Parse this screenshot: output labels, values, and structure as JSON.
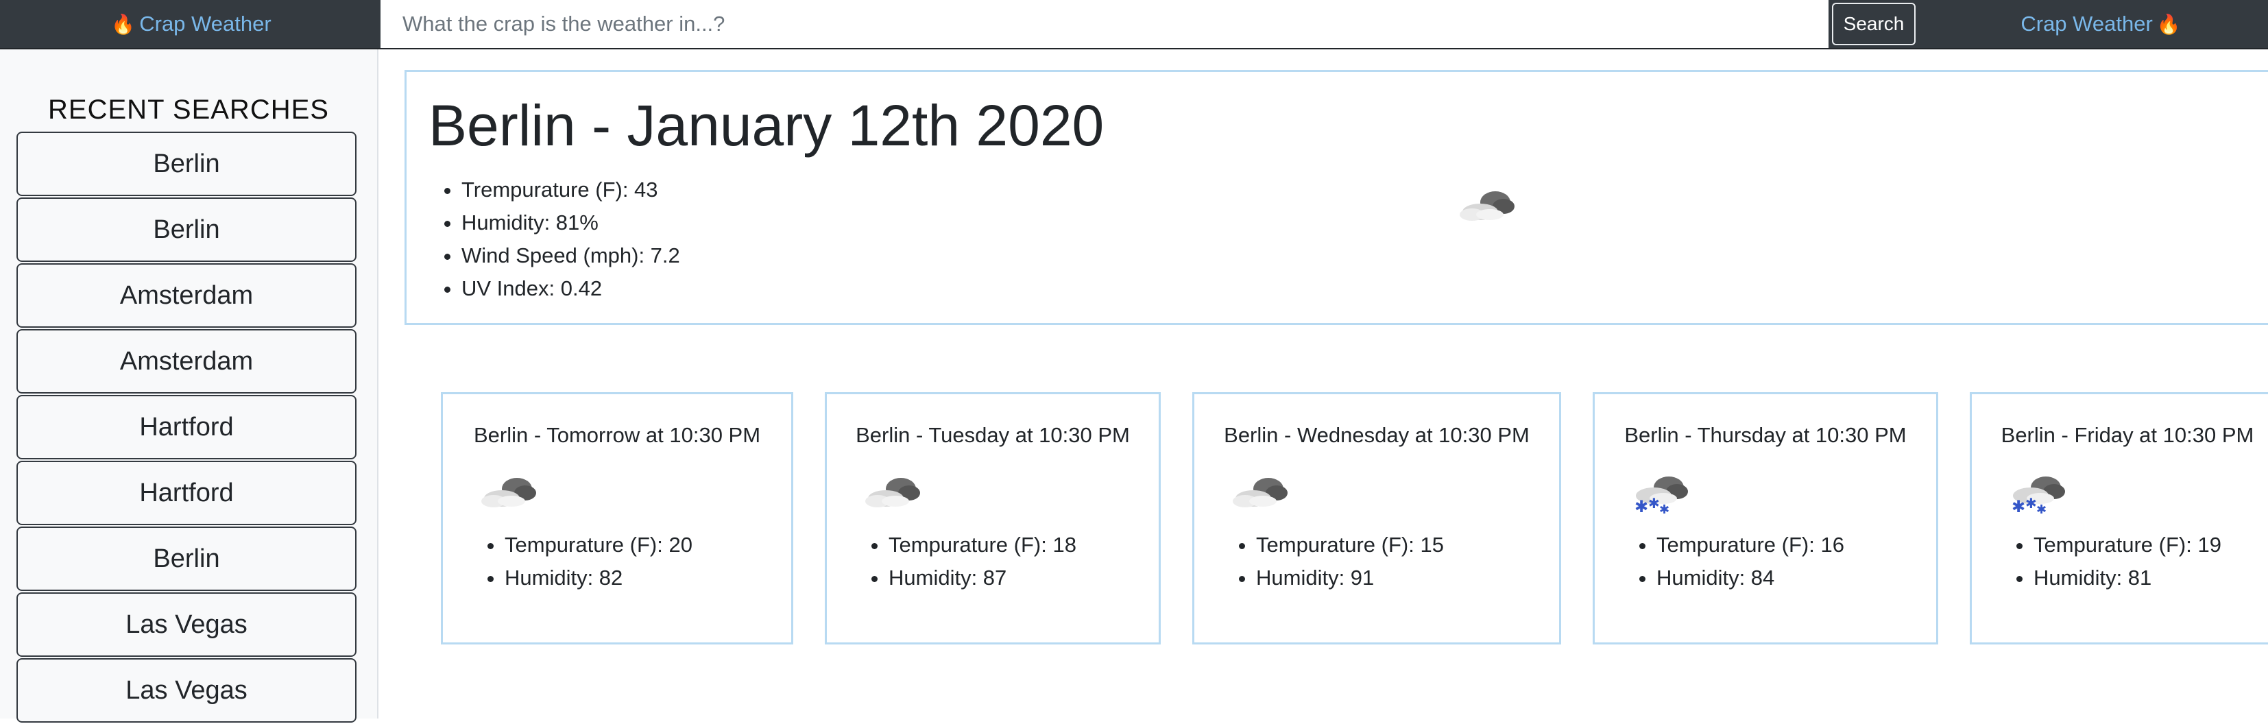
{
  "nav": {
    "brand_left": "Crap Weather",
    "brand_right": "Crap Weather",
    "search": {
      "placeholder": "What the crap is the weather in...?",
      "value": ""
    },
    "search_button": "Search"
  },
  "sidebar": {
    "title": "RECENT SEARCHES",
    "items": [
      {
        "label": "Berlin"
      },
      {
        "label": "Berlin"
      },
      {
        "label": "Amsterdam"
      },
      {
        "label": "Amsterdam"
      },
      {
        "label": "Hartford"
      },
      {
        "label": "Hartford"
      },
      {
        "label": "Berlin"
      },
      {
        "label": "Las Vegas"
      },
      {
        "label": "Las Vegas"
      }
    ]
  },
  "current": {
    "title": "Berlin - January 12th 2020",
    "details": [
      "Trempurature (F): 43",
      "Humidity: 81%",
      "Wind Speed (mph): 7.2",
      "UV Index: 0.42"
    ],
    "icon": "cloudy-icon"
  },
  "forecast": [
    {
      "title": "Berlin - Tomorrow at 10:30 PM",
      "icon": "cloudy-icon",
      "temp": "Tempurature (F): 20",
      "humidity": "Humidity: 82"
    },
    {
      "title": "Berlin - Tuesday at 10:30 PM",
      "icon": "cloudy-icon",
      "temp": "Tempurature (F): 18",
      "humidity": "Humidity: 87"
    },
    {
      "title": "Berlin - Wednesday at 10:30 PM",
      "icon": "cloudy-icon",
      "temp": "Tempurature (F): 15",
      "humidity": "Humidity: 91"
    },
    {
      "title": "Berlin - Thursday at 10:30 PM",
      "icon": "snow-cloud-icon",
      "temp": "Tempurature (F): 16",
      "humidity": "Humidity: 84"
    },
    {
      "title": "Berlin - Friday at 10:30 PM",
      "icon": "snow-cloud-icon",
      "temp": "Tempurature (F): 19",
      "humidity": "Humidity: 81"
    }
  ],
  "colors": {
    "navbar": "#343a40",
    "brand": "#7ab8ea",
    "card_border": "#b8daf2",
    "sidebar_bg": "#f8f9fa"
  }
}
